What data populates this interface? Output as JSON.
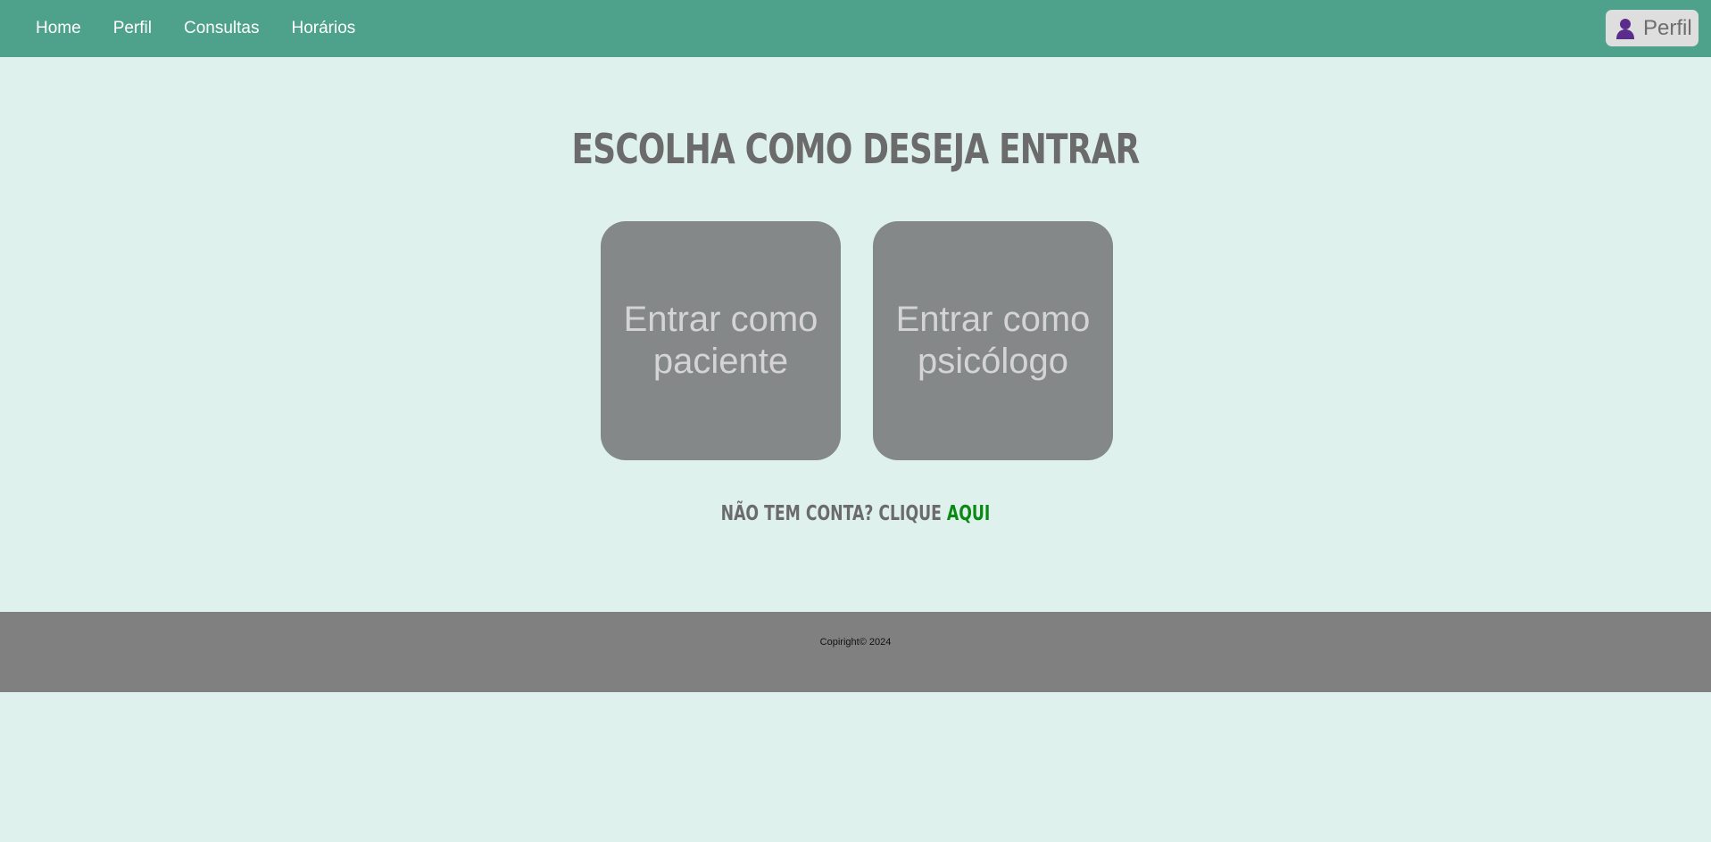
{
  "nav": {
    "links": [
      "Home",
      "Perfil",
      "Consultas",
      "Horários"
    ],
    "profile_label": "Perfil",
    "profile_icon": "user-icon"
  },
  "main": {
    "title": "Escolha como deseja entrar",
    "cards": [
      {
        "label": "Entrar como paciente"
      },
      {
        "label": "Entrar como psicólogo"
      }
    ],
    "signup_prefix": "Não tem conta? Clique ",
    "signup_link": "Aqui"
  },
  "footer": {
    "copyright": "Copiright© 2024"
  },
  "colors": {
    "navbar": "#4ea28b",
    "background": "#dff1ec",
    "card": "#848889",
    "footer": "#808080",
    "link_accent": "#0a8a14",
    "icon_purple": "#5b2d8a"
  }
}
